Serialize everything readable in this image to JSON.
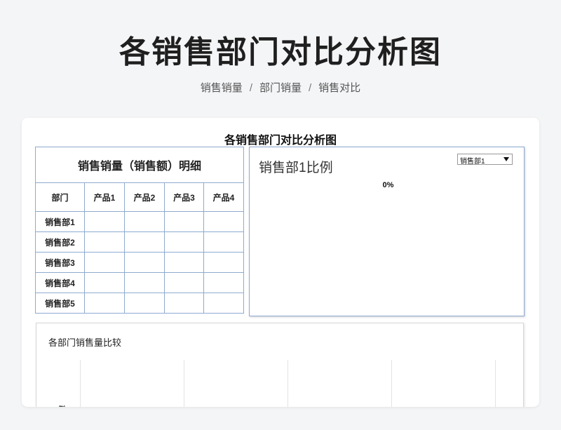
{
  "page": {
    "title": "各销售部门对比分析图"
  },
  "breadcrumb": [
    "销售销量",
    "部门销量",
    "销售对比"
  ],
  "sheet": {
    "title": "各销售部门对比分析图"
  },
  "detail_table": {
    "heading": "销售销量（销售额）明细",
    "columns": [
      "部门",
      "产品1",
      "产品2",
      "产品3",
      "产品4"
    ],
    "rows": [
      [
        "销售部1",
        "",
        "",
        "",
        ""
      ],
      [
        "销售部2",
        "",
        "",
        "",
        ""
      ],
      [
        "销售部3",
        "",
        "",
        "",
        ""
      ],
      [
        "销售部4",
        "",
        "",
        "",
        ""
      ],
      [
        "销售部5",
        "",
        "",
        "",
        ""
      ]
    ]
  },
  "pie_chart": {
    "title": "销售部1比例",
    "percent_label": "0%",
    "selected_department": "销售部1"
  },
  "bar_chart": {
    "title": "各部门销售量比较",
    "axis_label_fragment": "例"
  }
}
